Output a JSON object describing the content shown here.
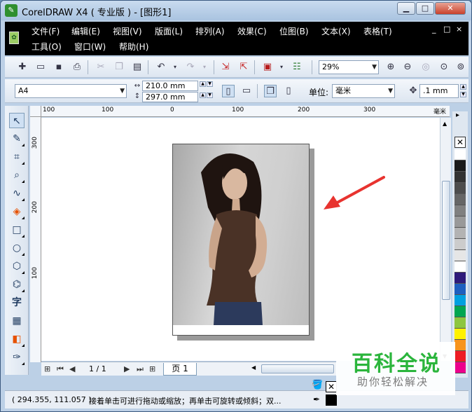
{
  "window": {
    "title": "CorelDRAW X4 ( 专业版 ) - [图形1]",
    "app_icon": "coreldraw-logo-icon",
    "controls": {
      "minimize": "▁",
      "maximize": "□",
      "close": "✕"
    }
  },
  "menu": {
    "items": [
      "文件(F)",
      "编辑(E)",
      "视图(V)",
      "版面(L)",
      "排列(A)",
      "效果(C)",
      "位图(B)",
      "文本(X)",
      "表格(T)",
      "工具(O)",
      "窗口(W)",
      "帮助(H)"
    ],
    "doc_controls": [
      "_",
      "□",
      "×"
    ]
  },
  "toolbar": {
    "zoom": "29%"
  },
  "property_bar": {
    "paper_size": "A4",
    "width": "210.0 mm",
    "height": "297.0 mm",
    "unit_label": "单位:",
    "unit_value": "毫米",
    "nudge": ".1 mm"
  },
  "rulers": {
    "horizontal": [
      "100",
      "0",
      "100",
      "200",
      "300",
      "毫米"
    ],
    "vertical": [
      "300",
      "200",
      "100"
    ]
  },
  "page_nav": {
    "counter": "1 / 1",
    "tab": "页 1"
  },
  "status": {
    "coords": "( 294.355, 111.057 )",
    "message": "接着单击可进行拖动或缩放；再单击可旋转或倾斜；双..."
  },
  "palette": {
    "colors": [
      "#ffffff",
      "#1a1a1a",
      "#333333",
      "#4d4d4d",
      "#666666",
      "#808080",
      "#999999",
      "#b3b3b3",
      "#cccccc",
      "#e6e6e6",
      "#ffffff",
      "#2e1a7a",
      "#1e5fbf",
      "#00a0e0",
      "#00a651",
      "#8dc63f",
      "#fff200",
      "#f7941d",
      "#ed1c24",
      "#ec008c"
    ]
  },
  "watermark": {
    "title": "百科全说",
    "subtitle": "助你轻松解决"
  },
  "arrow_color": "#e8332f"
}
